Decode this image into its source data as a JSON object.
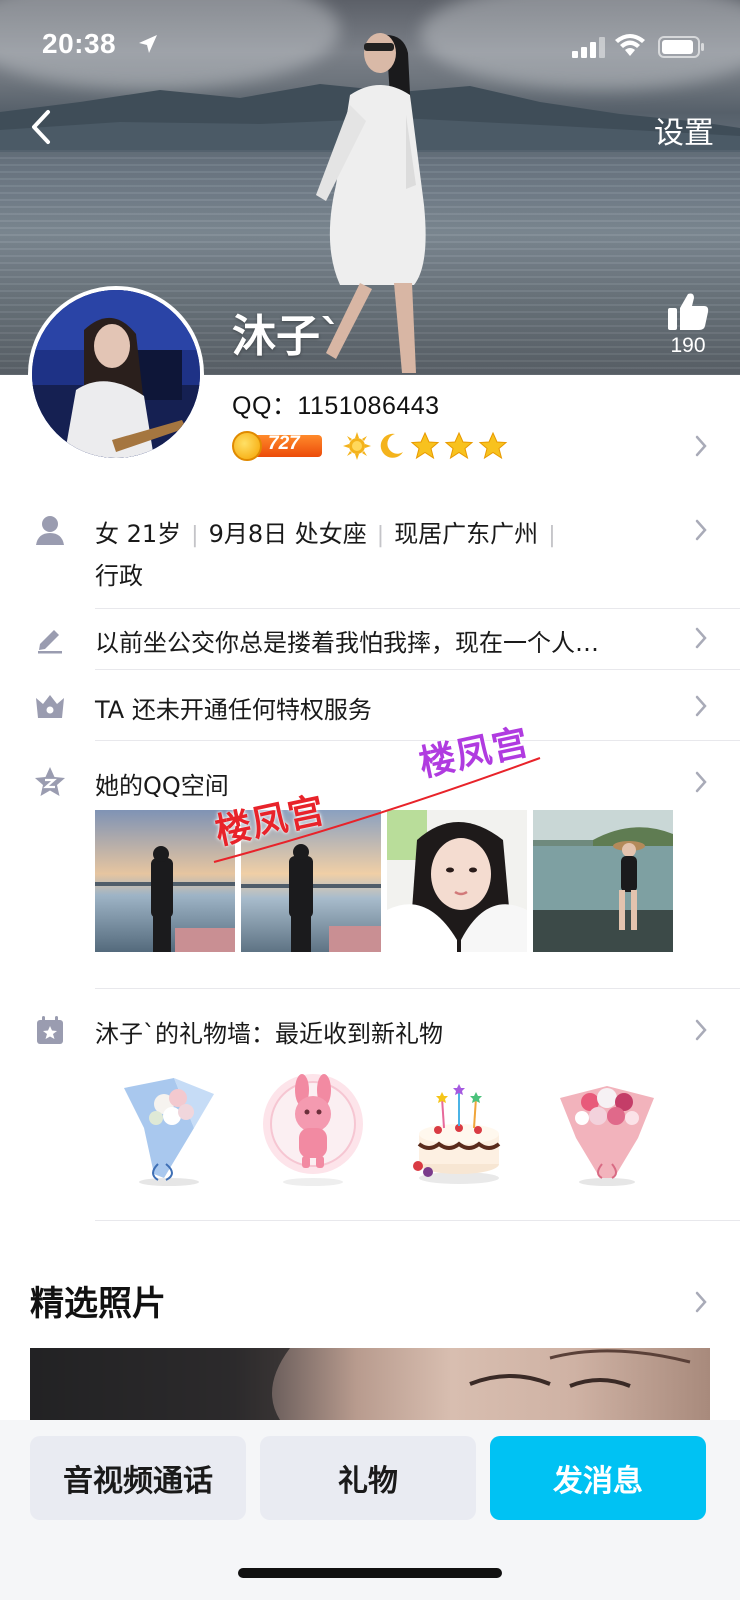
{
  "status_bar": {
    "time": "20:38"
  },
  "header": {
    "settings_label": "设置",
    "nickname": "沐子`",
    "like_count": "190"
  },
  "profile": {
    "qq_line": "QQ：1151086443",
    "coin_level": "727"
  },
  "info": {
    "basic_parts": [
      "女 21岁",
      "9月8日 处女座",
      "现居广东广州"
    ],
    "occupation": "行政",
    "signature": "以前坐公交你总是搂着我怕我摔，现在一个人…",
    "privilege": "TA 还未开通任何特权服务",
    "qzone_title": "她的QQ空间",
    "gift_wall_title": "沐子`的礼物墙：最近收到新礼物"
  },
  "watermarks": [
    "楼凤宫",
    "楼凤宫"
  ],
  "featured": {
    "title": "精选照片"
  },
  "actions": {
    "call_label": "音视频通话",
    "gift_label": "礼物",
    "message_label": "发消息"
  },
  "colors": {
    "accent": "#00c2f3",
    "coin_bar": "#ec4b0a",
    "icon_gray": "#9a9cb0",
    "watermark_red": "#e8232a",
    "watermark_purple": "#b03be0"
  }
}
